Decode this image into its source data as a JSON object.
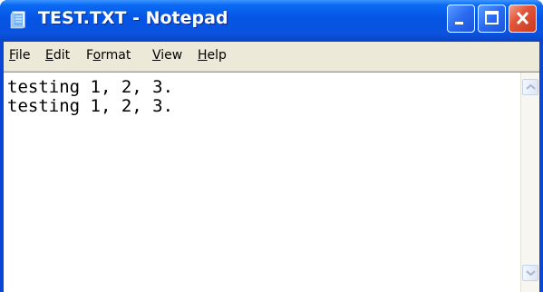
{
  "window": {
    "title": "TEST.TXT - Notepad",
    "app_icon": "notepad-icon",
    "controls": [
      "minimize",
      "maximize",
      "close"
    ],
    "accent_color": "#0a53df",
    "close_color": "#e0553a"
  },
  "menubar": {
    "items": [
      {
        "label_prefix": "",
        "mnemonic": "F",
        "label_rest": "ile"
      },
      {
        "label_prefix": "",
        "mnemonic": "E",
        "label_rest": "dit"
      },
      {
        "label_prefix": "F",
        "mnemonic": "o",
        "label_rest": "rmat"
      },
      {
        "label_prefix": "",
        "mnemonic": "V",
        "label_rest": "iew"
      },
      {
        "label_prefix": "",
        "mnemonic": "H",
        "label_rest": "elp"
      }
    ]
  },
  "editor": {
    "content": "testing 1, 2, 3.\ntesting 1, 2, 3."
  }
}
